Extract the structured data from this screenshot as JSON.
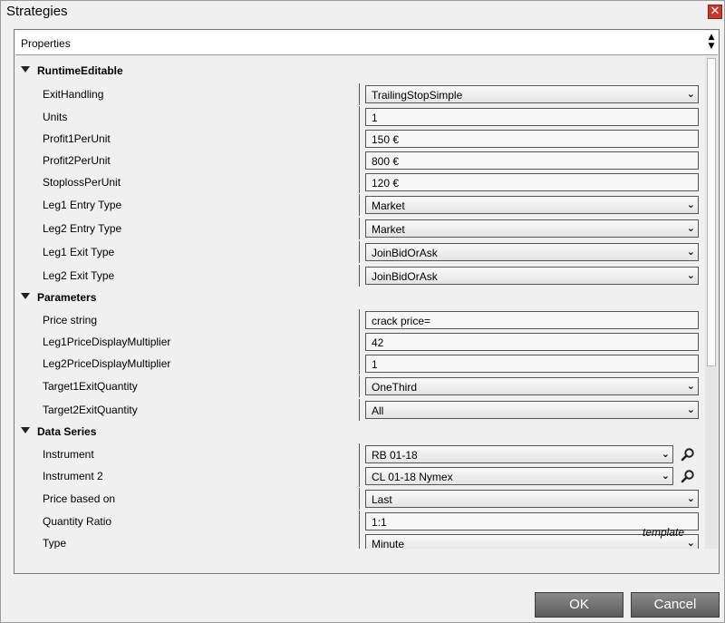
{
  "window": {
    "title": "Strategies"
  },
  "header": {
    "properties_label": "Properties",
    "sort_up": "▲",
    "sort_down": "▼"
  },
  "categories": {
    "runtime": "RuntimeEditable",
    "parameters": "Parameters",
    "data_series": "Data Series"
  },
  "rows": {
    "exit_handling": {
      "label": "ExitHandling",
      "value": "TrailingStopSimple"
    },
    "units": {
      "label": "Units",
      "value": "1"
    },
    "profit1": {
      "label": "Profit1PerUnit",
      "value": "150 €"
    },
    "profit2": {
      "label": "Profit2PerUnit",
      "value": "800 €"
    },
    "stoploss": {
      "label": "StoplossPerUnit",
      "value": "120 €"
    },
    "leg1_entry": {
      "label": "Leg1 Entry Type",
      "value": "Market"
    },
    "leg2_entry": {
      "label": "Leg2 Entry Type",
      "value": "Market"
    },
    "leg1_exit": {
      "label": "Leg1 Exit Type",
      "value": "JoinBidOrAsk"
    },
    "leg2_exit": {
      "label": "Leg2 Exit Type",
      "value": "JoinBidOrAsk"
    },
    "price_string": {
      "label": "Price string",
      "value": "crack price="
    },
    "leg1_mult": {
      "label": "Leg1PriceDisplayMultiplier",
      "value": "42"
    },
    "leg2_mult": {
      "label": "Leg2PriceDisplayMultiplier",
      "value": "1"
    },
    "target1": {
      "label": "Target1ExitQuantity",
      "value": "OneThird"
    },
    "target2": {
      "label": "Target2ExitQuantity",
      "value": "All"
    },
    "instrument": {
      "label": "Instrument",
      "value": "RB 01-18"
    },
    "instrument2": {
      "label": "Instrument 2",
      "value": "CL 01-18 Nymex"
    },
    "price_based": {
      "label": "Price based on",
      "value": "Last"
    },
    "qty_ratio": {
      "label": "Quantity Ratio",
      "value": "1:1"
    },
    "type": {
      "label": "Type",
      "value": "Minute"
    }
  },
  "footer": {
    "template_link": "template"
  },
  "buttons": {
    "ok": "OK",
    "cancel": "Cancel"
  },
  "icons": {
    "close": "close-icon",
    "search": "search-icon",
    "dropdown": "chevron-down-icon"
  },
  "colors": {
    "close_red": "#c8392e",
    "button_dark": "#6e6e6e"
  }
}
